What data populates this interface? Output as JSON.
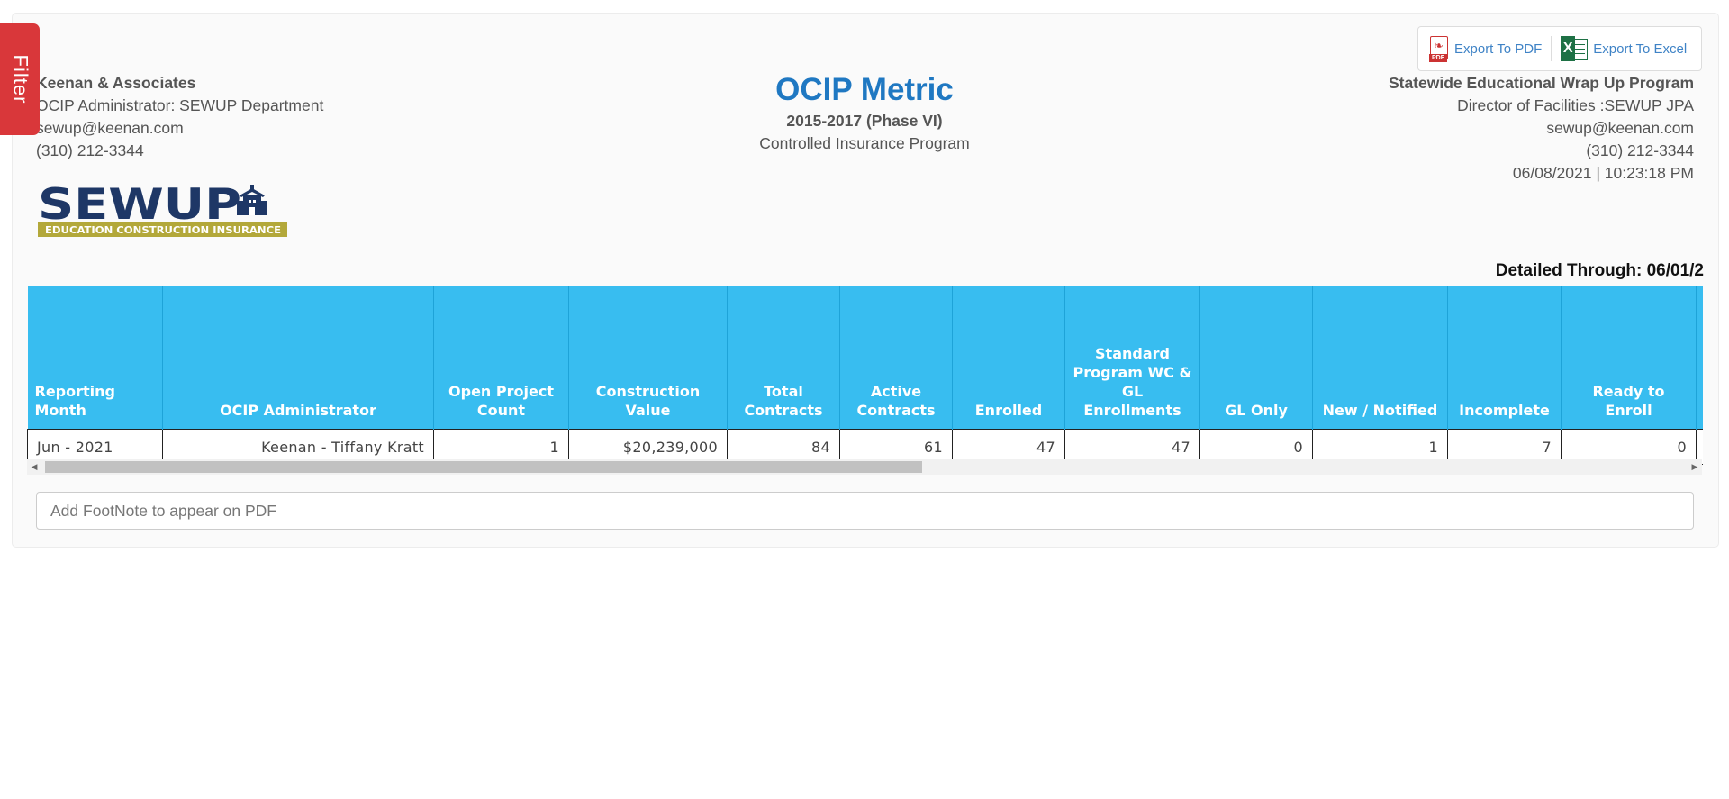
{
  "filter": {
    "label": "Filter"
  },
  "left": {
    "company": "Keenan & Associates",
    "role": "OCIP Administrator: SEWUP Department",
    "email": "sewup@keenan.com",
    "phone": "(310) 212-3344"
  },
  "center": {
    "title": "OCIP Metric",
    "subtitle": "2015-2017 (Phase VI)",
    "program": "Controlled Insurance Program"
  },
  "right": {
    "program": "Statewide Educational Wrap Up Program",
    "role": "Director of Facilities :SEWUP JPA",
    "email": "sewup@keenan.com",
    "phone": "(310) 212-3344",
    "datetime": "06/08/2021 | 10:23:18 PM"
  },
  "export": {
    "pdf": "Export To PDF",
    "excel": "Export To Excel",
    "pdf_tag": "PDF"
  },
  "logo": {
    "text": "SEWUP",
    "tagline": "EDUCATION CONSTRUCTION INSURANCE"
  },
  "detailed_through": "Detailed Through: 06/01/2",
  "table": {
    "headers": [
      "Reporting Month",
      "OCIP Administrator",
      "Open Project Count",
      "Construction Value",
      "Total Contracts",
      "Active Contracts",
      "Enrolled",
      "Standard Program WC & GL Enrollments",
      "GL Only",
      "New / Notified",
      "Incomplete",
      "Ready to Enroll"
    ],
    "rows": [
      [
        "Jun - 2021",
        "Keenan - Tiffany Kratt",
        "1",
        "$20,239,000",
        "84",
        "61",
        "47",
        "47",
        "0",
        "1",
        "7",
        "0"
      ]
    ]
  },
  "footnote": {
    "placeholder": "Add FootNote to appear on PDF"
  },
  "colors": {
    "accent": "#1f78c2",
    "header_bg": "#38bdf0",
    "filter_bg": "#d9373a",
    "logo_navy": "#1e3766",
    "logo_gold": "#b3a83a"
  }
}
